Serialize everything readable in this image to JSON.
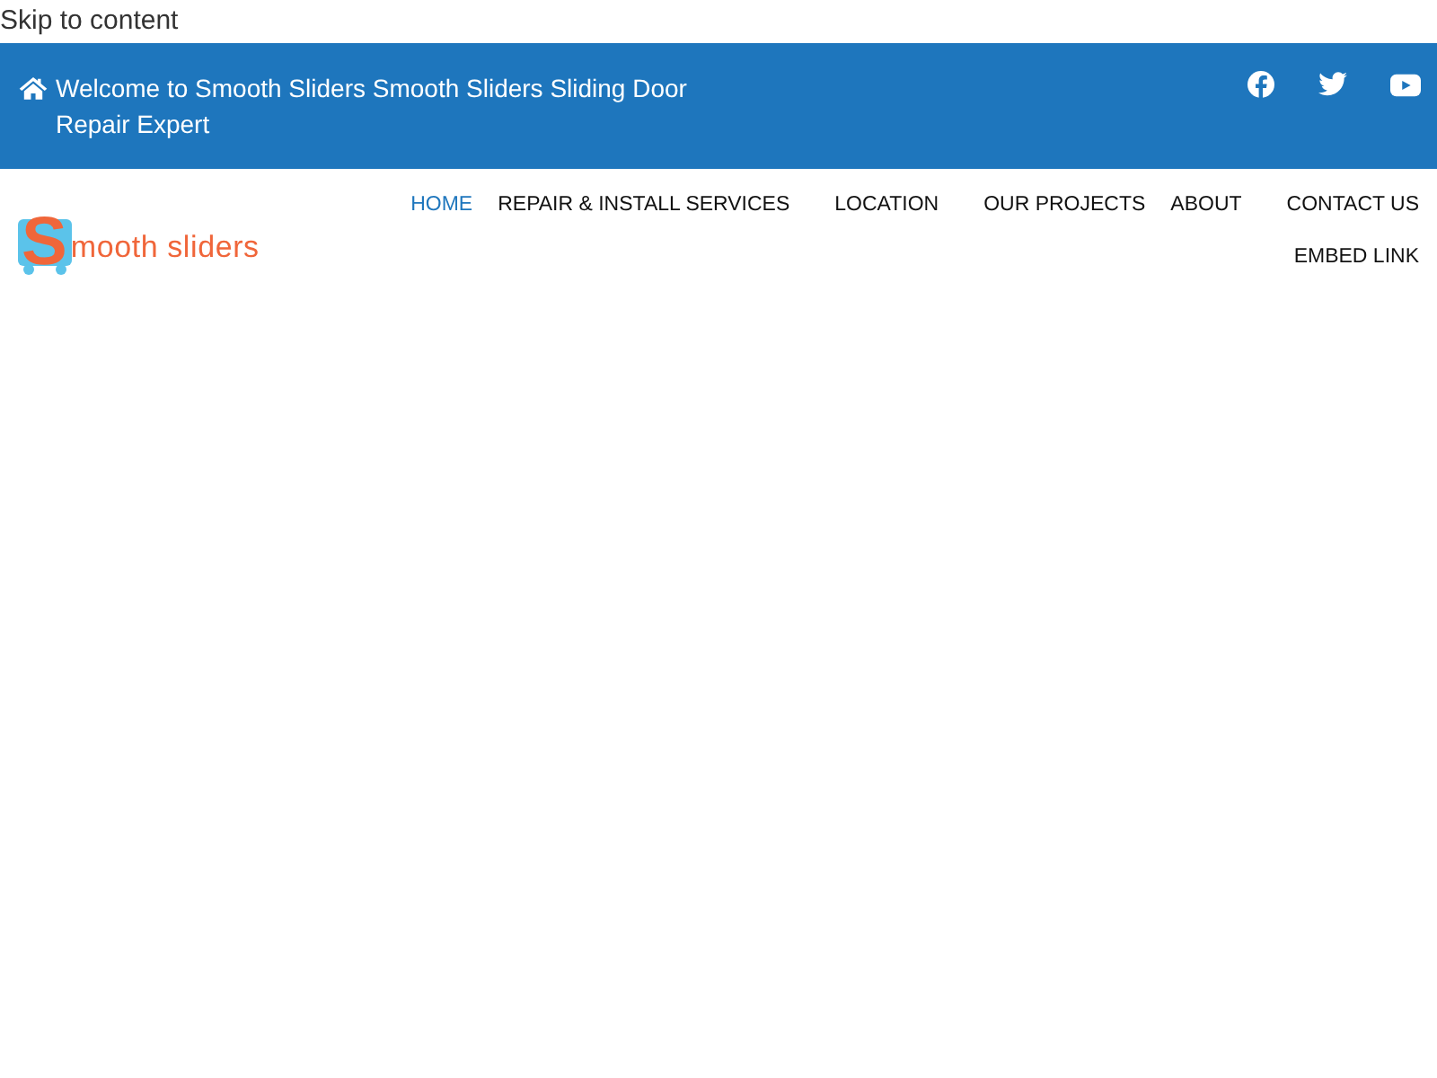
{
  "skip_link": "Skip to content",
  "top_bar": {
    "welcome": "Welcome to Smooth Sliders Smooth Sliders Sliding Door Repair Expert",
    "social": [
      {
        "kind": "facebook"
      },
      {
        "kind": "twitter"
      },
      {
        "kind": "youtube"
      }
    ]
  },
  "logo": {
    "text": "Smooth sliders"
  },
  "nav": [
    {
      "label": "HOME",
      "selected": true
    },
    {
      "label": "REPAIR & INSTALL SERVICES",
      "selected": false
    },
    {
      "label": "LOCATION",
      "selected": false
    },
    {
      "label": "OUR PROJECTS",
      "selected": false
    },
    {
      "label": "ABOUT",
      "selected": false
    },
    {
      "label": "CONTACT US",
      "selected": false
    },
    {
      "label": "EMBED LINK",
      "selected": false
    }
  ]
}
